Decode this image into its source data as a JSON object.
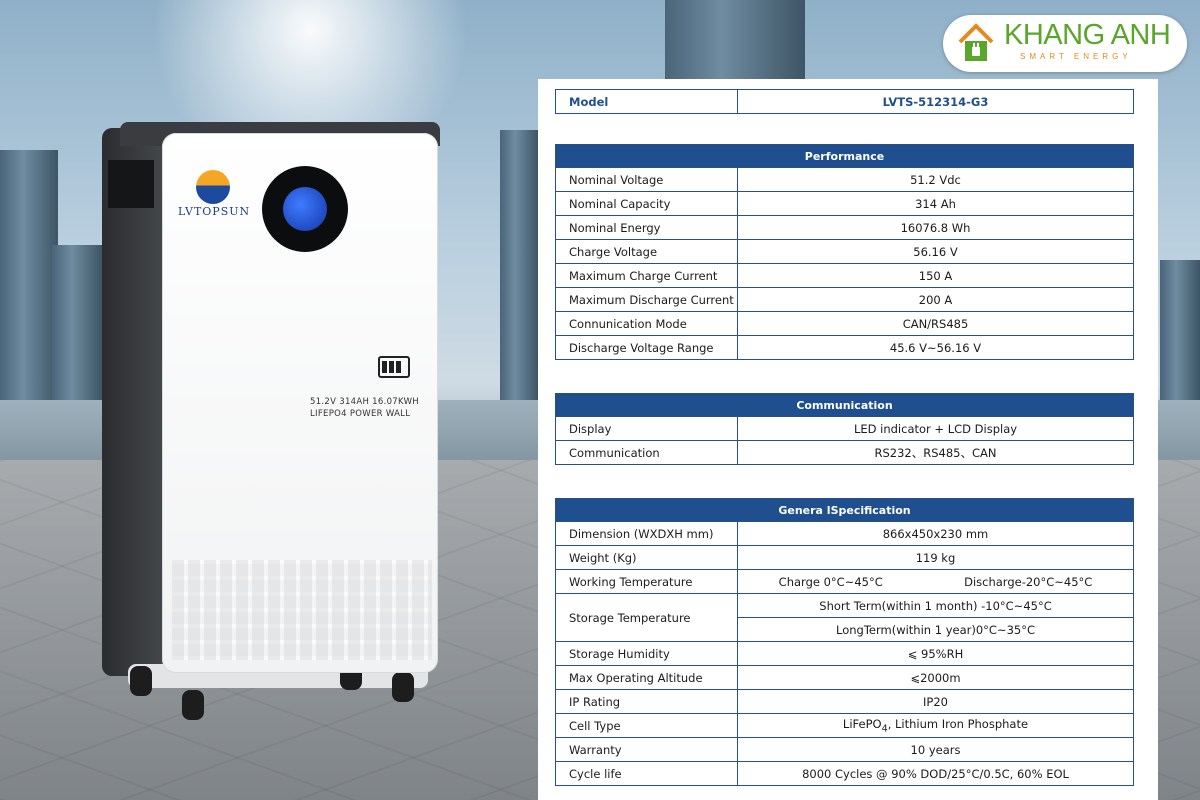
{
  "brand": {
    "name": "KHANG ANH",
    "tagline": "SMART ENERGY",
    "green": "#5aa62b",
    "orange": "#e58a1f"
  },
  "product": {
    "logo_text": "LVTOPSUN",
    "label_line1": "51.2V 314AH 16.07KWH",
    "label_line2": "LIFEPO4 POWER WALL",
    "knob_color": "#1f4fd0"
  },
  "model": {
    "label": "Model",
    "value": "LVTS-512314-G3"
  },
  "sections": {
    "performance": {
      "title": "Performance",
      "rows": [
        {
          "k": "Nominal Voltage",
          "v": "51.2 Vdc"
        },
        {
          "k": "Nominal Capacity",
          "v": "314 Ah"
        },
        {
          "k": "Nominal Energy",
          "v": "16076.8 Wh"
        },
        {
          "k": "Charge Voltage",
          "v": "56.16 V"
        },
        {
          "k": "Maximum Charge Current",
          "v": "150 A"
        },
        {
          "k": "Maximum Discharge Current",
          "v": "200 A"
        },
        {
          "k": "Connunication Mode",
          "v": "CAN/RS485"
        },
        {
          "k": "Discharge Voltage Range",
          "v": "45.6 V~56.16 V"
        }
      ]
    },
    "communication": {
      "title": "Communication",
      "rows": [
        {
          "k": "Display",
          "v": "LED indicator + LCD Display"
        },
        {
          "k": "Communication",
          "v": "RS232、RS485、CAN"
        }
      ]
    },
    "general": {
      "title": "Genera lSpecification",
      "dimension": {
        "k": "Dimension (WXDXH mm)",
        "v": "866x450x230 mm"
      },
      "weight": {
        "k": "Weight (Kg)",
        "v": "119 kg"
      },
      "working_temp": {
        "k": "Working Temperature",
        "charge": "Charge 0°C~45°C",
        "discharge": "Discharge-20°C~45°C"
      },
      "storage_temp": {
        "k": "Storage Temperature",
        "short": "Short Term(within 1 month) -10°C~45°C",
        "long": "LongTerm(within 1 year)0°C~35°C"
      },
      "humidity": {
        "k": "Storage Humidity",
        "v": "⩽ 95%RH"
      },
      "altitude": {
        "k": "Max Operating Altitude",
        "v": "⩽2000m"
      },
      "ip": {
        "k": "IP Rating",
        "v": "IP20"
      },
      "cell": {
        "k": "Cell Type",
        "v_pre": "LiFePO",
        "v_sub": "4",
        "v_post": ", Lithium Iron Phosphate"
      },
      "warranty": {
        "k": "Warranty",
        "v": "10 years"
      },
      "cycle": {
        "k": "Cycle life",
        "v": "8000 Cycles @ 90% DOD/25°C/0.5C, 60% EOL"
      }
    }
  }
}
